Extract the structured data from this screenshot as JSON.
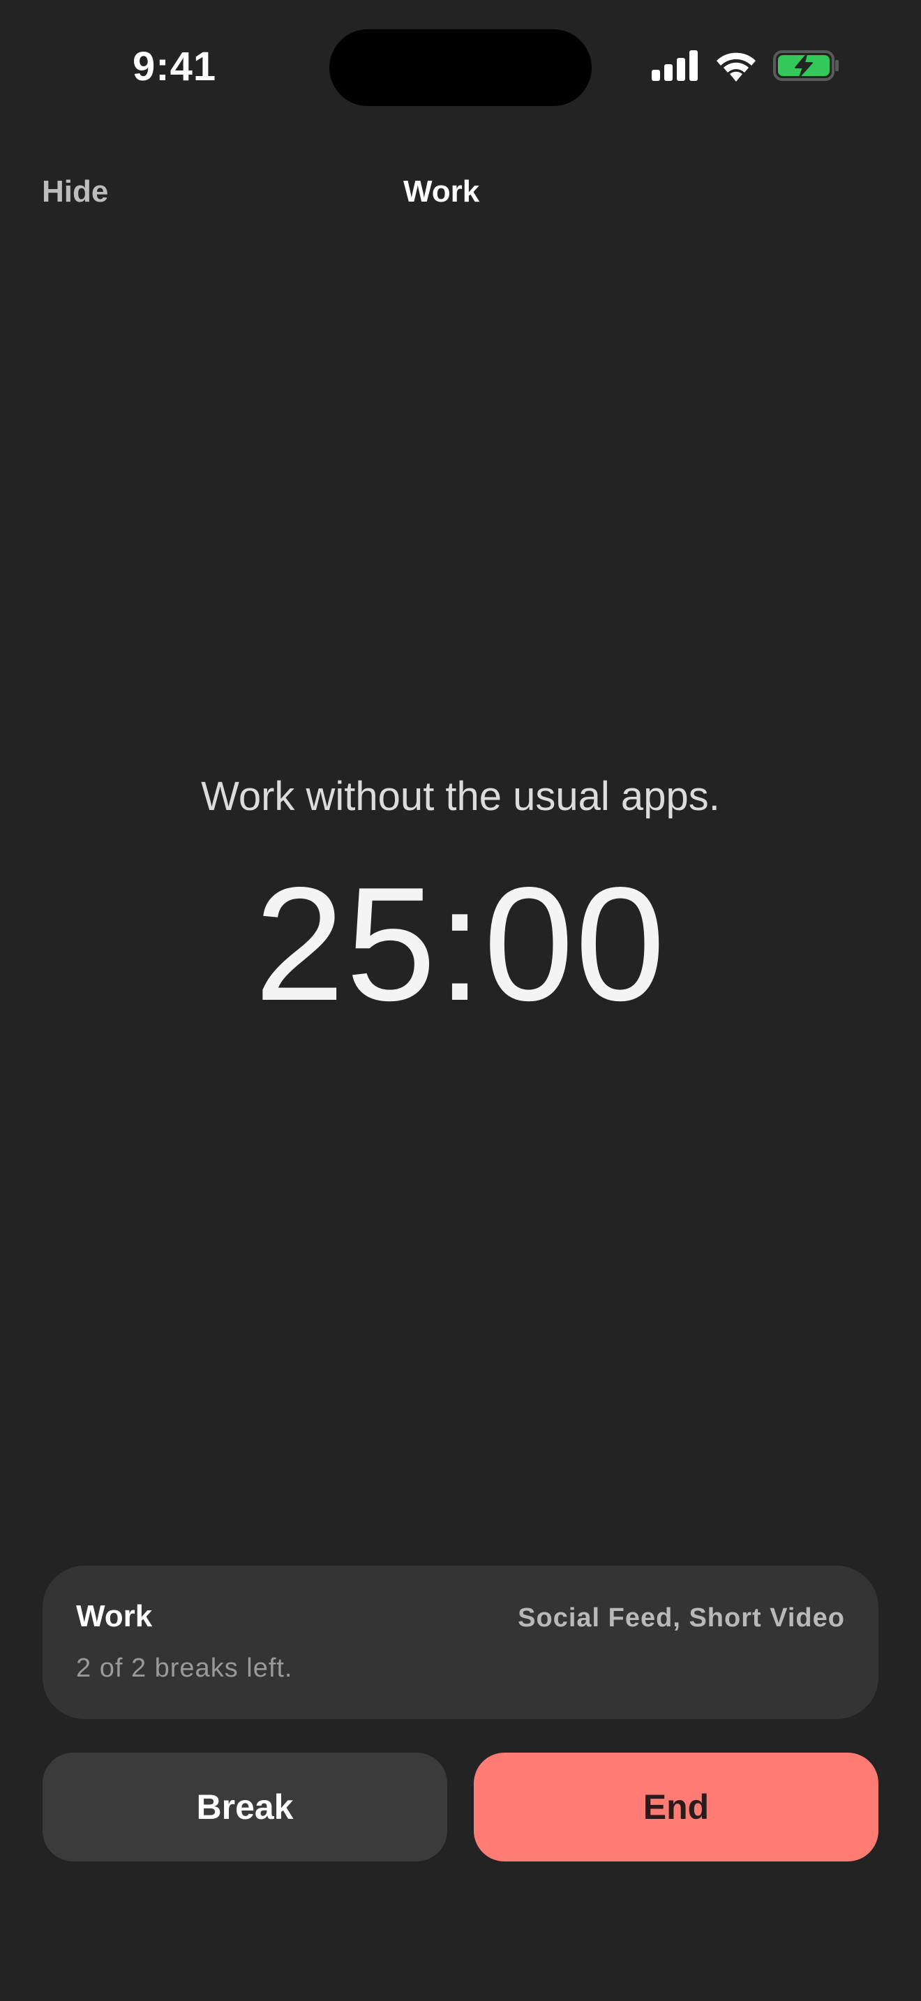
{
  "status_bar": {
    "time": "9:41",
    "icons": [
      "cellular-signal-icon",
      "wifi-icon",
      "battery-charging-icon"
    ],
    "battery_color": "#34c759"
  },
  "nav": {
    "hide_label": "Hide",
    "title": "Work"
  },
  "main": {
    "subtitle": "Work without the usual apps.",
    "timer": "25:00"
  },
  "session": {
    "name": "Work",
    "blocked_apps": "Social Feed, Short Video",
    "breaks_text": "2 of 2 breaks left."
  },
  "actions": {
    "break_label": "Break",
    "end_label": "End",
    "end_color": "#ff7c74"
  }
}
